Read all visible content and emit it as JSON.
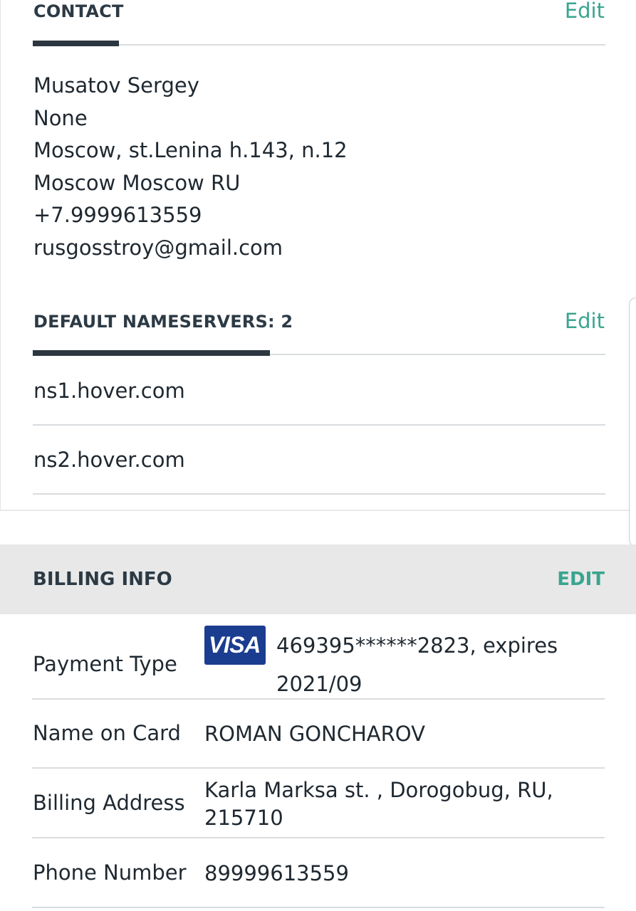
{
  "contact": {
    "title": "CONTACT",
    "edit_label": "Edit",
    "lines": [
      "Musatov Sergey",
      "None",
      "Moscow, st.Lenina h.143, n.12",
      "Moscow Moscow RU",
      "+7.9999613559",
      "rusgosstroy@gmail.com"
    ]
  },
  "nameservers": {
    "title": "DEFAULT NAMESERVERS: 2",
    "edit_label": "Edit",
    "items": [
      "ns1.hover.com",
      "ns2.hover.com"
    ]
  },
  "billing": {
    "title": "BILLING INFO",
    "edit_label": "EDIT",
    "card_brand": "VISA",
    "rows": [
      {
        "label": "Payment Type",
        "value_line1": "469395******2823, expires",
        "value_line2": "2021/09"
      },
      {
        "label": "Name on Card",
        "value": "ROMAN GONCHAROV"
      },
      {
        "label": "Billing Address",
        "value_line1": "Karla Marksa st. , Dorogobug, RU,",
        "value_line2": "215710"
      },
      {
        "label": "Phone Number",
        "value": "89999613559"
      }
    ]
  },
  "colors": {
    "accent": "#3aa58f",
    "heading": "#2c3a45",
    "active_underline": "#2c3640",
    "billing_header_bg": "#e8e8e8",
    "visa_blue": "#1a3d8f"
  },
  "icons": {
    "card_brand_icon": "visa-logo-icon"
  }
}
